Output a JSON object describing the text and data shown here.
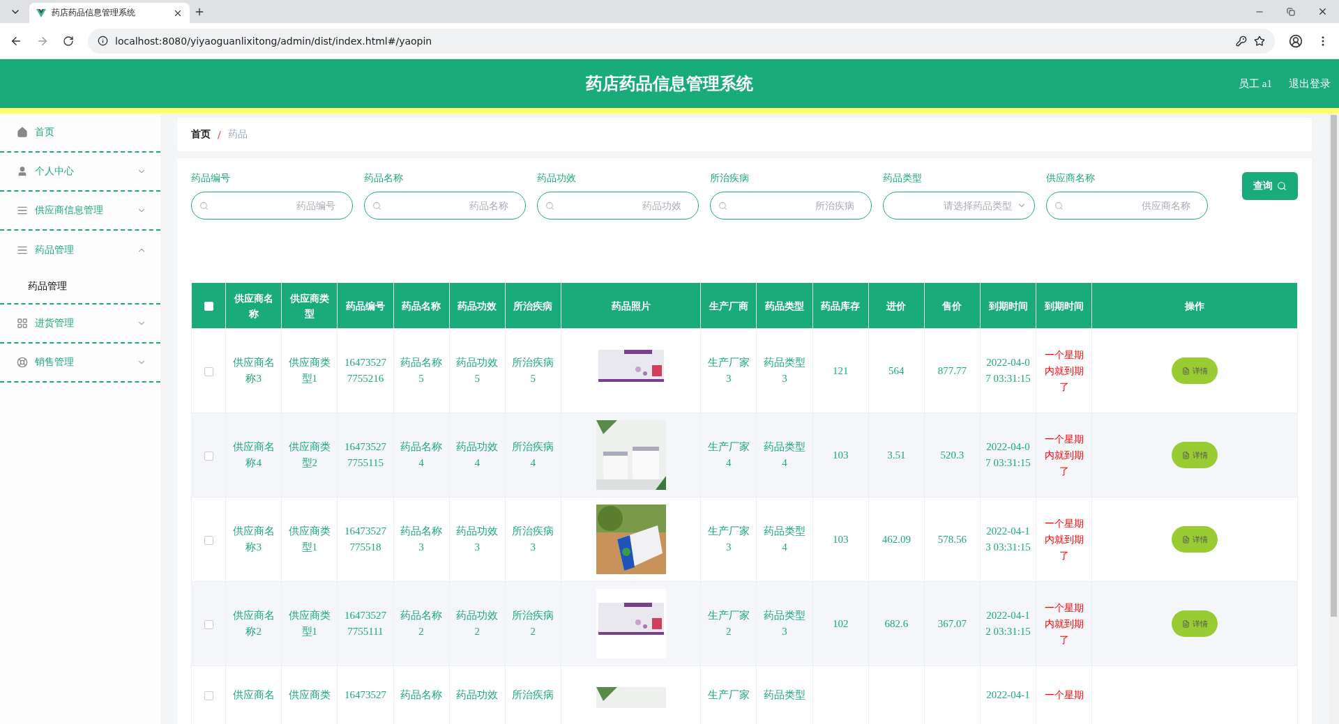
{
  "browser": {
    "tab_title": "药店药品信息管理系统",
    "url": "localhost:8080/yiyaoguanlixitong/admin/dist/index.html#/yaopin"
  },
  "header": {
    "title": "药店药品信息管理系统",
    "user": "员工 a1",
    "logout": "退出登录"
  },
  "sidebar": {
    "items": [
      {
        "label": "首页"
      },
      {
        "label": "个人中心",
        "expanded": false
      },
      {
        "label": "供应商信息管理",
        "expanded": false
      },
      {
        "label": "药品管理",
        "expanded": true,
        "children": [
          {
            "label": "药品管理",
            "selected": true
          }
        ]
      },
      {
        "label": "进货管理",
        "expanded": false
      },
      {
        "label": "销售管理",
        "expanded": false
      }
    ]
  },
  "breadcrumb": [
    {
      "label": "首页"
    },
    {
      "label": "/",
      "kind": "separator"
    },
    {
      "label": "药品"
    }
  ],
  "search": {
    "fields": [
      {
        "label": "药品编号",
        "placeholder": "药品编号",
        "kind": "text"
      },
      {
        "label": "药品名称",
        "placeholder": "药品名称",
        "kind": "text"
      },
      {
        "label": "药品功效",
        "placeholder": "药品功效",
        "kind": "text"
      },
      {
        "label": "所治疾病",
        "placeholder": "所治疾病",
        "kind": "text"
      },
      {
        "label": "药品类型",
        "placeholder": "请选择药品类型",
        "kind": "select"
      },
      {
        "label": "供应商名称",
        "placeholder": "供应商名称",
        "kind": "text"
      }
    ],
    "button": "查询"
  },
  "table": {
    "select_all_checked": false,
    "columns": [
      "供应商名称",
      "供应商类型",
      "药品编号",
      "药品名称",
      "药品功效",
      "所治疾病",
      "药品照片",
      "生产厂商",
      "药品类型",
      "药品库存",
      "进价",
      "售价",
      "到期时间",
      "到期时间",
      "操作"
    ],
    "rows": [
      {
        "checked": false,
        "supplier_name": "供应商名称3",
        "supplier_type": "供应商类型1",
        "code": "164735277755216",
        "name": "药品名称5",
        "efficacy": "药品功效5",
        "disease": "所治疾病5",
        "manufacturer": "生产厂家3",
        "type": "药品类型3",
        "stock": "121",
        "cost_price": "564",
        "sale_price": "877.77",
        "expiry_date": "2022-04-07 03:31:15",
        "expiry_status": "一个星期内就到期了",
        "action": "详情"
      },
      {
        "checked": false,
        "supplier_name": "供应商名称4",
        "supplier_type": "供应商类型2",
        "code": "164735277755115",
        "name": "药品名称4",
        "efficacy": "药品功效4",
        "disease": "所治疾病4",
        "manufacturer": "生产厂家4",
        "type": "药品类型4",
        "stock": "103",
        "cost_price": "3.51",
        "sale_price": "520.3",
        "expiry_date": "2022-04-07 03:31:15",
        "expiry_status": "一个星期内就到期了",
        "action": "详情"
      },
      {
        "checked": false,
        "supplier_name": "供应商名称3",
        "supplier_type": "供应商类型1",
        "code": "16473527775518",
        "name": "药品名称3",
        "efficacy": "药品功效3",
        "disease": "所治疾病3",
        "manufacturer": "生产厂家3",
        "type": "药品类型4",
        "stock": "103",
        "cost_price": "462.09",
        "sale_price": "578.56",
        "expiry_date": "2022-04-13 03:31:15",
        "expiry_status": "一个星期内就到期了",
        "action": "详情"
      },
      {
        "checked": false,
        "supplier_name": "供应商名称2",
        "supplier_type": "供应商类型1",
        "code": "164735277755111",
        "name": "药品名称2",
        "efficacy": "药品功效2",
        "disease": "所治疾病2",
        "manufacturer": "生产厂家2",
        "type": "药品类型3",
        "stock": "102",
        "cost_price": "682.6",
        "sale_price": "367.07",
        "expiry_date": "2022-04-12 03:31:15",
        "expiry_status": "一个星期内就到期了",
        "action": "详情"
      },
      {
        "checked": false,
        "supplier_name": "供应商名",
        "supplier_type": "供应商类",
        "code": "16473527",
        "name": "药品名称",
        "efficacy": "药品功效",
        "disease": "所治疾病",
        "manufacturer": "生产厂家",
        "type": "药品类型",
        "expiry_date": "2022-04-1",
        "expiry_status": "一个星期"
      }
    ]
  }
}
